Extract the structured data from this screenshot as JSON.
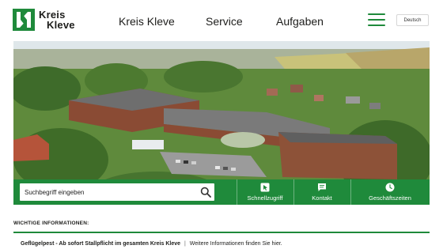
{
  "header": {
    "logo": {
      "line1": "Kreis",
      "line2": "Kleve"
    },
    "nav": [
      {
        "label": "Kreis Kleve"
      },
      {
        "label": "Service"
      },
      {
        "label": "Aufgaben"
      }
    ],
    "language_label": "Deutsch"
  },
  "quickbar": {
    "search_placeholder": "Suchbegriff eingeben",
    "items": [
      {
        "label": "Schnellzugriff",
        "icon": "cursor-icon"
      },
      {
        "label": "Kontakt",
        "icon": "message-icon"
      },
      {
        "label": "Geschäftszeiten",
        "icon": "clock-icon"
      }
    ]
  },
  "info": {
    "title": "WICHTIGE INFORMATIONEN:",
    "headline": "Geflügelpest - Ab sofort Stallpflicht im gesamten Kreis Kleve",
    "separator": "|",
    "link": "Weitere Informationen finden Sie hier."
  },
  "colors": {
    "brand_green": "#1f8a3b",
    "text": "#1d1d1b"
  }
}
